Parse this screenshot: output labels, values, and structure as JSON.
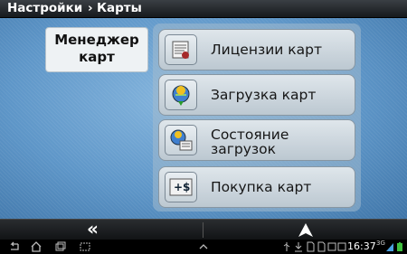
{
  "header": {
    "breadcrumb_root": "Настройки",
    "breadcrumb_separator": "›",
    "breadcrumb_current": "Карты"
  },
  "panel": {
    "title_line1": "Менеджер",
    "title_line2": "карт"
  },
  "menu": [
    {
      "label": "Лицензии карт",
      "icon": "license-icon"
    },
    {
      "label": "Загрузка карт",
      "icon": "globe-download-icon"
    },
    {
      "label_line1": "Состояние",
      "label_line2": "загрузок",
      "icon": "globe-status-icon"
    },
    {
      "label": "Покупка карт",
      "icon": "purchase-icon"
    }
  ],
  "action_bar": {
    "back_icon": "double-chevron-left-icon",
    "up_icon": "triangle-up-icon"
  },
  "status_bar": {
    "time": "16:37",
    "network_label": "3G"
  },
  "colors": {
    "background": "#5e96c8",
    "button": "#cfd8df",
    "header": "#1e2226"
  }
}
